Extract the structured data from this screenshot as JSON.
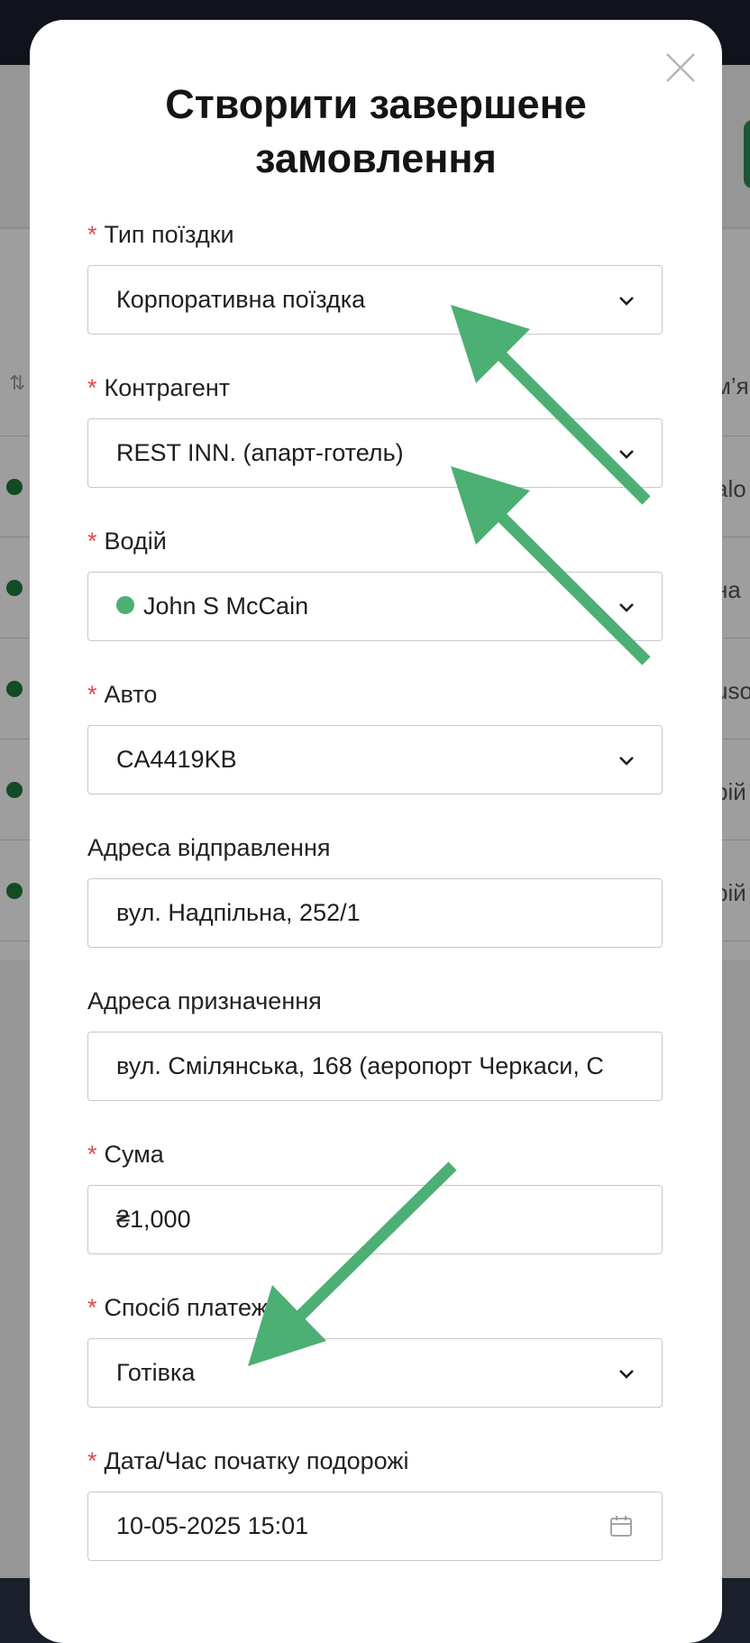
{
  "background": {
    "row_fragments": [
      "alo",
      "на",
      "uso",
      "рій",
      "рій"
    ],
    "header_fragment": "м’я"
  },
  "modal": {
    "title": "Створити завершене замовлення",
    "required_marker": "*",
    "fields": [
      {
        "label": "Тип поїздки",
        "value": "Корпоративна поїздка",
        "required": true,
        "kind": "select"
      },
      {
        "label": "Контрагент",
        "value": "REST INN. (апарт-готель)",
        "required": true,
        "kind": "select"
      },
      {
        "label": "Водій",
        "value": "John S McCain",
        "required": true,
        "kind": "select",
        "status_color": "#4caf73"
      },
      {
        "label": "Авто",
        "value": "CA4419KB",
        "required": true,
        "kind": "select"
      },
      {
        "label": "Адреса відправлення",
        "value": "вул. Надпільна, 252/1",
        "required": false,
        "kind": "input"
      },
      {
        "label": "Адреса призначення",
        "value": "вул. Смілянська, 168 (аеропорт Черкаси, С",
        "required": false,
        "kind": "input"
      },
      {
        "label": "Сума",
        "value": "₴1,000",
        "required": true,
        "kind": "input"
      },
      {
        "label": "Спосіб платеж",
        "value": "Готівка",
        "required": true,
        "kind": "select"
      },
      {
        "label": "Дата/Час початку подорожі",
        "value": "10-05-2025 15:01",
        "required": true,
        "kind": "date"
      }
    ]
  },
  "colors": {
    "arrow": "#4caf73",
    "required": "#e5484d"
  },
  "icons": {
    "close": "close-icon",
    "chevron": "chevron-down-icon",
    "calendar": "calendar-icon"
  }
}
